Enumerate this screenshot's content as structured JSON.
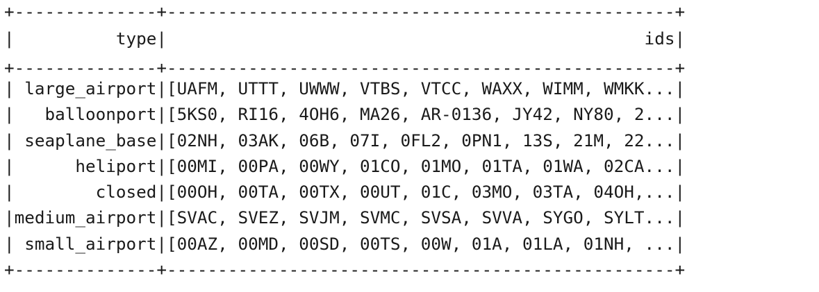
{
  "table": {
    "border": "+--------------+--------------------------------------------------+",
    "header": "|          type|                                               ids|",
    "rows": [
      "| large_airport|[UAFM, UTTT, UWWW, VTBS, VTCC, WAXX, WIMM, WMKK...|",
      "|   balloonport|[5KS0, RI16, 4OH6, MA26, AR-0136, JY42, NY80, 2...|",
      "| seaplane_base|[02NH, 03AK, 06B, 07I, 0FL2, 0PN1, 13S, 21M, 22...|",
      "|      heliport|[00MI, 00PA, 00WY, 01CO, 01MO, 01TA, 01WA, 02CA...|",
      "|        closed|[00OH, 00TA, 00TX, 00UT, 01C, 03MO, 03TA, 04OH,...|",
      "|medium_airport|[SVAC, SVEZ, SVJM, SVMC, SVSA, SVVA, SYGO, SYLT...|",
      "| small_airport|[00AZ, 00MD, 00SD, 00TS, 00W, 01A, 01LA, 01NH, ...|"
    ]
  }
}
